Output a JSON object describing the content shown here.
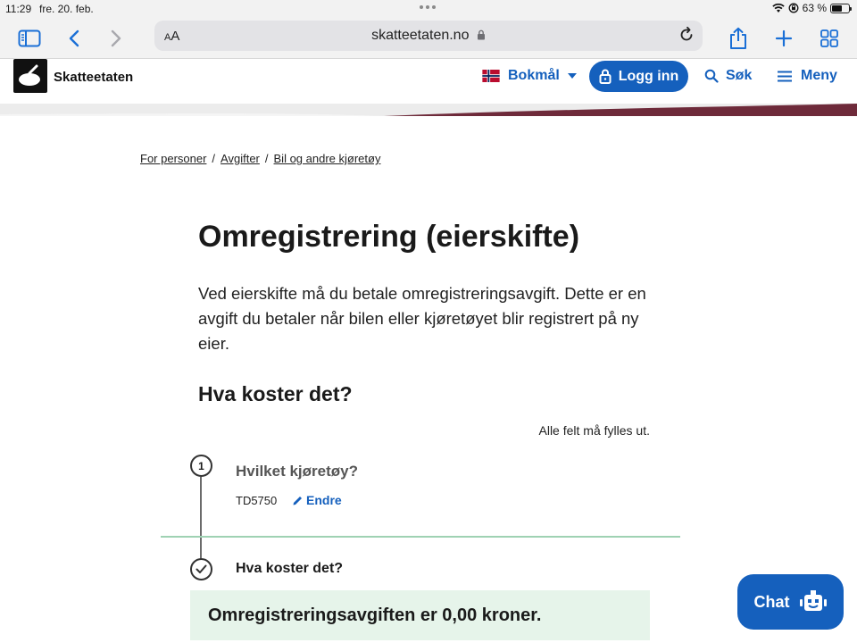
{
  "status": {
    "time": "11:29",
    "date": "fre. 20. feb.",
    "battery": "63 %",
    "battery_level": 0.63
  },
  "browser": {
    "text_size": "AA",
    "url": "skatteetaten.no"
  },
  "header": {
    "site_name": "Skatteetaten",
    "language": "Bokmål",
    "login": "Logg inn",
    "search": "Søk",
    "menu": "Meny"
  },
  "breadcrumb": [
    "For personer",
    "Avgifter",
    "Bil og andre kjøretøy"
  ],
  "breadcrumb_separator": "/",
  "page": {
    "title": "Omregistrering (eierskifte)",
    "intro": "Ved eierskifte må du betale omregistreringsavgift. Dette er en avgift du betaler når bilen eller kjøretøyet blir registrert på ny eier.",
    "section_title": "Hva koster det?",
    "required_note": "Alle felt må fylles ut."
  },
  "steps": {
    "step1": {
      "number": "1",
      "title": "Hvilket kjøretøy?",
      "value": "TD5750",
      "change": "Endre"
    },
    "step2": {
      "title": "Hva koster det?",
      "result": "Omregistreringsavgiften er 0,00 kroner."
    }
  },
  "chat": {
    "label": "Chat"
  },
  "colors": {
    "primary": "#1560bd",
    "result_bg": "#e6f4ea",
    "divider": "#9fd2b3",
    "accent_band": "#6e2a3a"
  }
}
